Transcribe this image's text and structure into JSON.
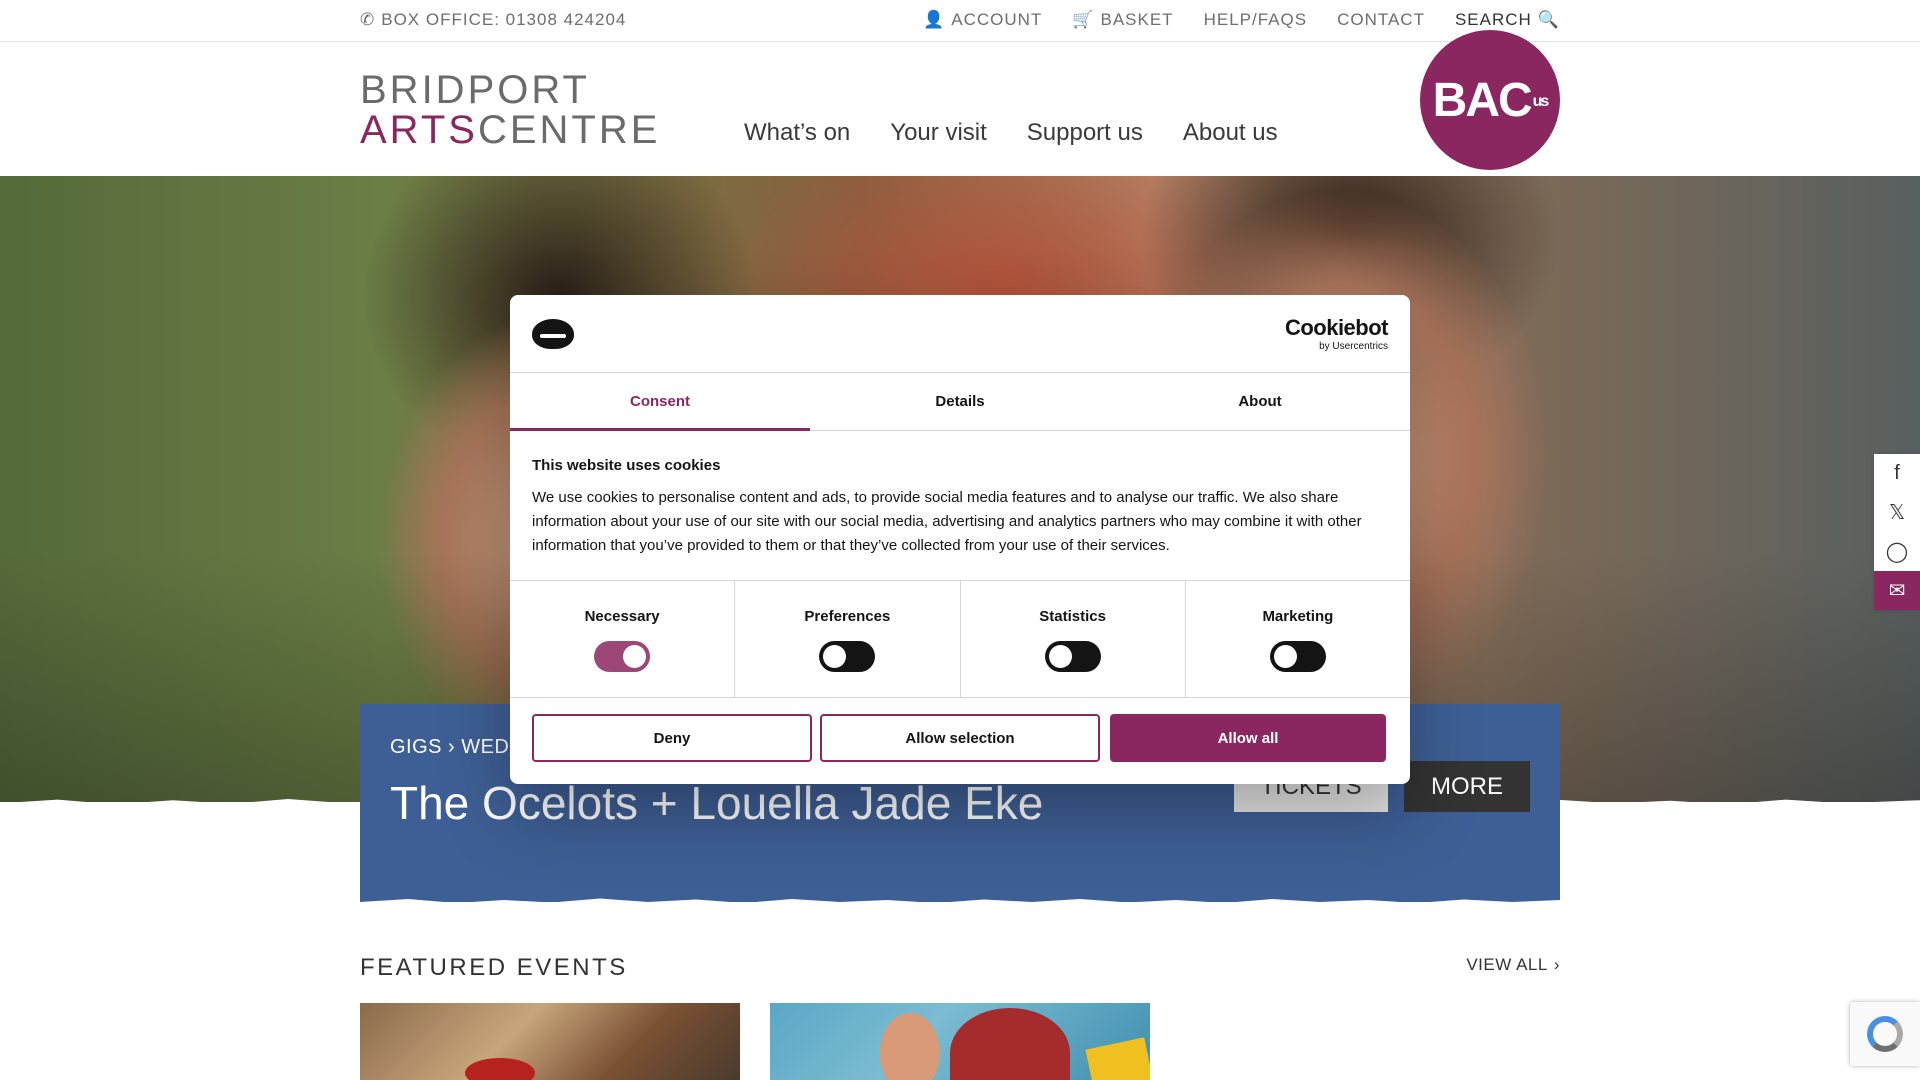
{
  "topbar": {
    "phone_icon": "phone-icon",
    "box_office": "BOX OFFICE: 01308 424204",
    "account": "ACCOUNT",
    "basket": "BASKET",
    "help": "HELP/FAQS",
    "contact": "CONTACT",
    "search": "SEARCH"
  },
  "logo": {
    "line1": "BRIDPORT",
    "arts": "ARTS",
    "centre": "CENTRE"
  },
  "nav": [
    "What’s on",
    "Your visit",
    "Support us",
    "About us"
  ],
  "badge": {
    "text": "BAC",
    "small": "us"
  },
  "event": {
    "category": "GIGS",
    "day": "WEDN",
    "title": "The Ocelots + Louella Jade Eke",
    "tickets": "TICKETS",
    "more": "MORE"
  },
  "featured": {
    "heading": "FEATURED EVENTS",
    "view_all": "VIEW ALL"
  },
  "social": [
    "facebook-icon",
    "x-icon",
    "instagram-icon",
    "newsletter-icon"
  ],
  "cookie": {
    "brand": "Cookiebot",
    "brand_sub": "by Usercentrics",
    "tabs": [
      "Consent",
      "Details",
      "About"
    ],
    "heading": "This website uses cookies",
    "text": "We use cookies to personalise content and ads, to provide social media features and to analyse our traffic. We also share information about your use of our site with our social media, advertising and analytics partners who may combine it with other information that you’ve provided to them or that they’ve collected from your use of their services.",
    "toggles": [
      {
        "label": "Necessary",
        "on": true
      },
      {
        "label": "Preferences",
        "on": false
      },
      {
        "label": "Statistics",
        "on": false
      },
      {
        "label": "Marketing",
        "on": false
      }
    ],
    "deny": "Deny",
    "allow_selection": "Allow selection",
    "allow_all": "Allow all"
  },
  "colors": {
    "brand": "#8b2760",
    "event_bg": "#3e5f95"
  }
}
